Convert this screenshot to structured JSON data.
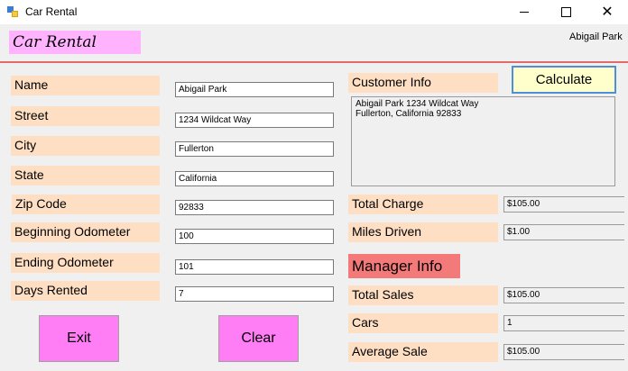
{
  "window": {
    "title": "Car Rental"
  },
  "header": {
    "app_label": "Car Rental",
    "user_name": "Abigail Park"
  },
  "form": {
    "name": {
      "label": "Name",
      "value": "Abigail Park"
    },
    "street": {
      "label": "Street",
      "value": "1234 Wildcat Way"
    },
    "city": {
      "label": "City",
      "value": "Fullerton"
    },
    "state": {
      "label": "State",
      "value": "California"
    },
    "zip": {
      "label": "Zip Code",
      "value": "92833"
    },
    "beginning_odometer": {
      "label": "Beginning Odometer",
      "value": "100"
    },
    "ending_odometer": {
      "label": "Ending Odometer",
      "value": "101"
    },
    "days_rented": {
      "label": "Days Rented",
      "value": "7"
    }
  },
  "buttons": {
    "calculate": "Calculate",
    "exit": "Exit",
    "clear": "Clear"
  },
  "customer_info": {
    "label": "Customer Info",
    "line1": "Abigail Park 1234 Wildcat Way",
    "line2": "Fullerton, California 92833"
  },
  "totals": {
    "total_charge": {
      "label": "Total Charge",
      "value": "$105.00"
    },
    "miles_driven": {
      "label": "Miles Driven",
      "value": "$1.00"
    }
  },
  "manager": {
    "label": "Manager Info",
    "total_sales": {
      "label": "Total Sales",
      "value": "$105.00"
    },
    "cars": {
      "label": "Cars",
      "value": "1"
    },
    "average_sale": {
      "label": "Average Sale",
      "value": "$105.00"
    }
  },
  "colors": {
    "label_bg": "#ffdfc4",
    "header_label_bg": "#ffb3ff",
    "manager_bg": "#f47a7a",
    "button_bg": "#ff7ef5",
    "calculate_bg": "#ffffcc",
    "divider": "#e26a6a"
  },
  "icons": {
    "app": "app-form-icon",
    "minimize": "minimize-icon",
    "maximize": "maximize-icon",
    "close": "close-icon"
  }
}
